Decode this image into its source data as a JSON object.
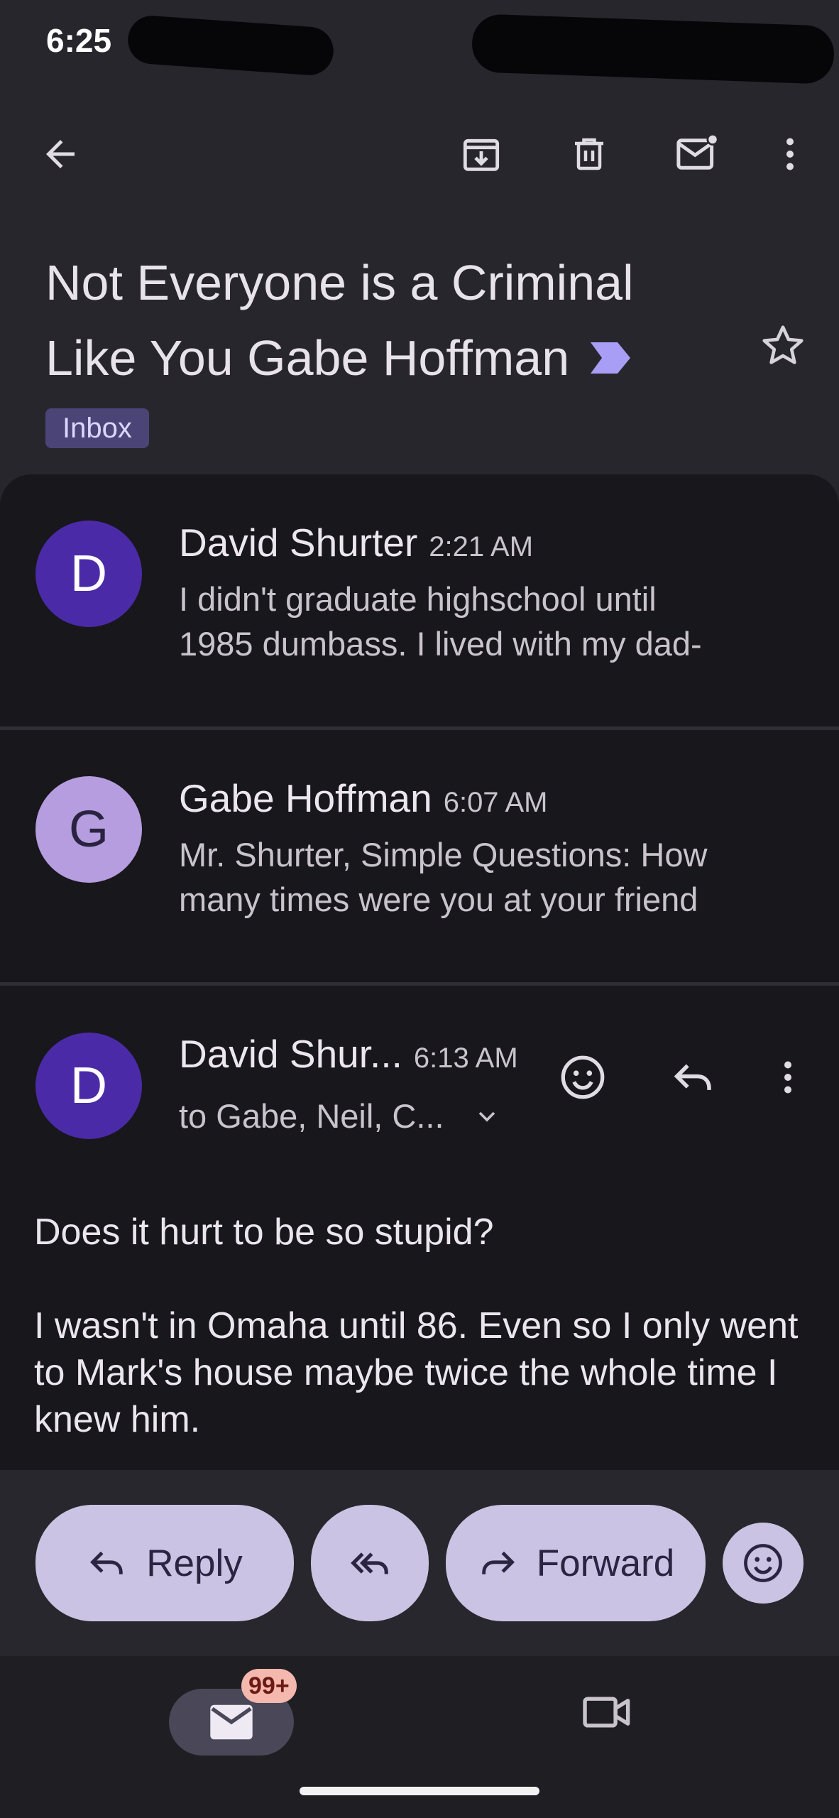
{
  "status_bar": {
    "time": "6:25"
  },
  "toolbar": {
    "back_icon": "arrow-left-icon",
    "archive_icon": "archive-icon",
    "delete_icon": "trash-icon",
    "mark_unread_icon": "mail-unread-icon",
    "more_icon": "more-vert-icon"
  },
  "subject": {
    "line1": "Not Everyone is a Criminal",
    "line2": "Like You Gabe Hoffman",
    "label": "Inbox"
  },
  "messages": [
    {
      "initial": "D",
      "sender": "David Shurter",
      "time": "2:21 AM",
      "snippet_line1": "I didn't graduate highschool until",
      "snippet_line2": "1985 dumbass. I lived with my dad-"
    },
    {
      "initial": "G",
      "sender": "Gabe Hoffman",
      "time": "6:07 AM",
      "snippet_line1": "Mr. Shurter, Simple Questions: How",
      "snippet_line2": "many times were you at your friend"
    }
  ],
  "open_message": {
    "initial": "D",
    "sender": "David Shur...",
    "time": "6:13 AM",
    "recipients": "to Gabe, Neil, C...",
    "body_p1": "Does it hurt to be so stupid?",
    "body_p2": "I wasn't in Omaha until 86. Even so I only went to Mark's house maybe twice the whole time I knew him."
  },
  "actions": {
    "reply": "Reply",
    "forward": "Forward"
  },
  "nav": {
    "mail_badge": "99+"
  },
  "colors": {
    "background": "#27262d",
    "panel": "#18171b",
    "avatar_d": "#4b2aa8",
    "avatar_g": "#b59de0",
    "pill": "#cbc3e3",
    "badge": "#f4b8ae",
    "label_chip": "#4a4576"
  }
}
